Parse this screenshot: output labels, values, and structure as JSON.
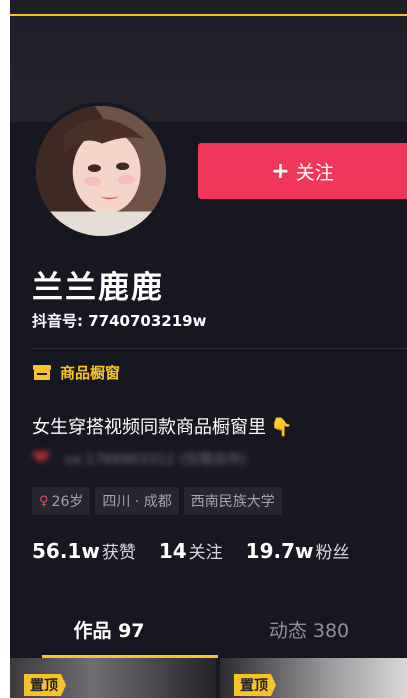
{
  "profile": {
    "name": "兰兰鹿鹿",
    "douyin_id_label": "抖音号",
    "douyin_id": "7740703219w",
    "follow_label": "关注",
    "shop_label": "商品橱窗",
    "bio": "女生穿搭视频同款商品橱窗里",
    "bio_emoji": "👇",
    "blurred_contact": "vx:1766903312 (仅限合作)",
    "tags": {
      "age": "26岁",
      "location": "四川 · 成都",
      "school": "西南民族大学"
    },
    "stats": {
      "likes_value": "56.1w",
      "likes_label": "获赞",
      "following_value": "14",
      "following_label": "关注",
      "followers_value": "19.7w",
      "followers_label": "粉丝"
    }
  },
  "tabs": {
    "works": "作品 97",
    "dynamic": "动态 380"
  },
  "grid": {
    "pin_label_1": "置顶",
    "pin_label_2": "置顶"
  },
  "colors": {
    "background": "#171722",
    "follow_button": "#f0375a",
    "accent_yellow": "#f6c32a"
  }
}
